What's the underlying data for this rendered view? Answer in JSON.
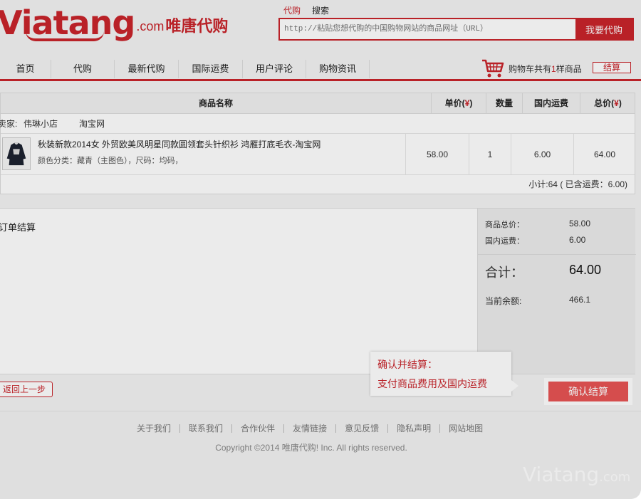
{
  "header": {
    "logo_main": "Viatang",
    "logo_com": ".com",
    "logo_cn": "唯唐代购",
    "search_tabs": [
      "代购",
      "搜索"
    ],
    "search_placeholder": "http://粘贴您想代购的中国购物网站的商品网址（URL）",
    "search_button": "我要代购"
  },
  "nav": {
    "items": [
      "首页",
      "代购",
      "最新代购",
      "国际运费",
      "用户评论",
      "购物资讯"
    ],
    "cart_prefix": "购物车共有",
    "cart_count": "1",
    "cart_suffix": "样商品",
    "checkout_label": "结算"
  },
  "table": {
    "headers": {
      "name": "商品名称",
      "unit_price": "单价(",
      "qty": "数量",
      "shipping": "国内运费",
      "total": "总价(",
      "yen": "¥",
      "close": ")"
    },
    "seller_label": "卖家:",
    "seller_name": "伟琳小店",
    "seller_site": "淘宝网",
    "item": {
      "title": "秋装新款2014女 外贸欧美风明星同款圆领套头针织衫 鸿雁打底毛衣-淘宝网",
      "attributes": "颜色分类：藏青（主图色），尺码：均码，",
      "unit_price": "58.00",
      "qty": "1",
      "shipping": "6.00",
      "total": "64.00"
    },
    "subtotal": "小计:64 ( 已含运费：6.00)"
  },
  "order": {
    "title": "订单结算",
    "goods_total_label": "商品总价：",
    "goods_total": "58.00",
    "shipping_label": "国内运费：",
    "shipping": "6.00",
    "grand_label": "合计：",
    "grand_total": "64.00",
    "balance_label": "当前余额:",
    "balance": "466.1",
    "back_button": "返回上一步",
    "confirm_button": "确认结算",
    "tooltip_line1": "确认并结算：",
    "tooltip_line2": "支付商品费用及国内运费"
  },
  "footer": {
    "links": [
      "关于我们",
      "联系我们",
      "合作伙伴",
      "友情链接",
      "意见反馈",
      "隐私声明",
      "网站地图"
    ],
    "copyright": "Copyright ©2014 唯唐代购! Inc. All rights reserved.",
    "watermark_main": "Viatang",
    "watermark_com": ".com"
  },
  "colors": {
    "brand_red": "#c9242b",
    "confirm_red": "#e85454"
  }
}
